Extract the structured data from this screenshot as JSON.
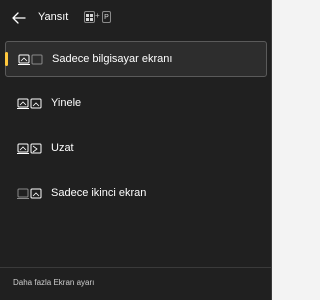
{
  "header": {
    "back_icon": "arrow-left-icon",
    "title": "Yansıt",
    "shortcut": {
      "key1_icon": "windows-logo-icon",
      "plus": "+",
      "key2": "P"
    }
  },
  "options": [
    {
      "label": "Sadece bilgisayar ekranı",
      "icon": "pc-screen-only-icon",
      "selected": true
    },
    {
      "label": "Yinele",
      "icon": "duplicate-icon",
      "selected": false
    },
    {
      "label": "Uzat",
      "icon": "extend-icon",
      "selected": false
    },
    {
      "label": "Sadece ikinci ekran",
      "icon": "second-screen-only-icon",
      "selected": false
    }
  ],
  "footer": {
    "link": "Daha fazla Ekran ayarı"
  },
  "colors": {
    "panel_bg": "#202020",
    "accent": "#ffc83d",
    "selected_bg": "#2d2d2d"
  }
}
